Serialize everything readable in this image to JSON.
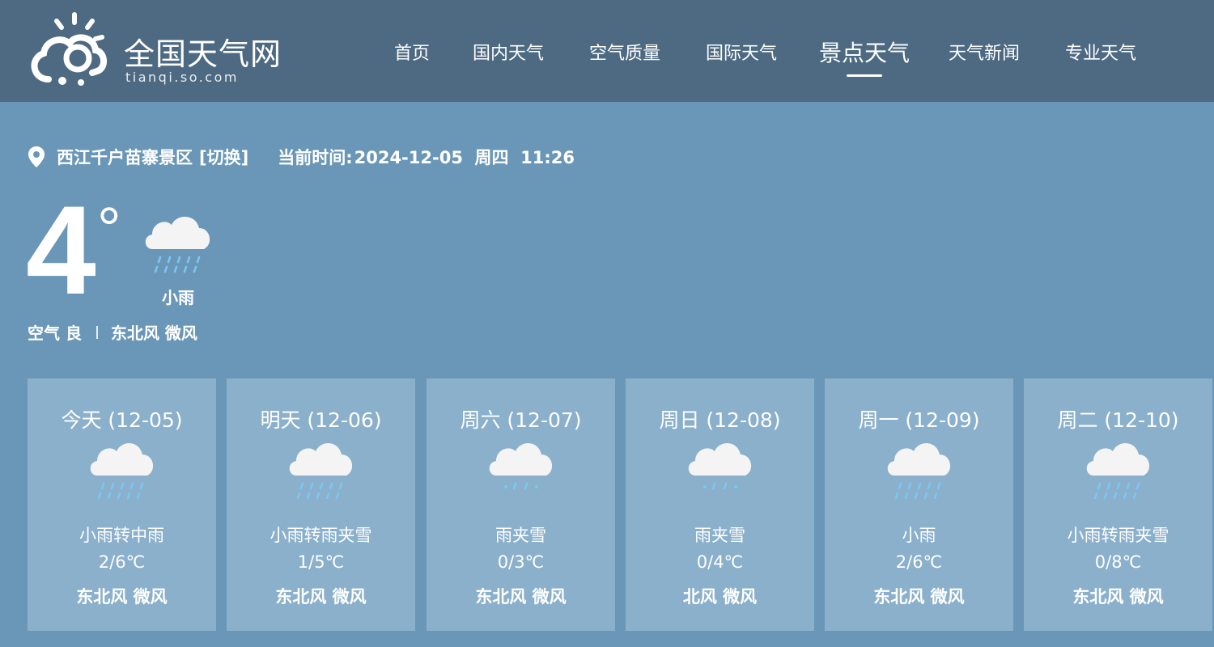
{
  "header": {
    "logo_name": "全国天气网",
    "logo_domain": "tianqi.so.com",
    "nav": [
      "首页",
      "国内天气",
      "空气质量",
      "国际天气",
      "景点天气",
      "天气新闻",
      "专业天气"
    ],
    "active_nav": "景点天气"
  },
  "location": {
    "name": "西江千户苗寨景区",
    "switch_label": "[切换]",
    "time_label": "当前时间:",
    "time_value": "2024-12-05  周四  11:26"
  },
  "current": {
    "temperature": "4",
    "degree_symbol": "°",
    "condition": "小雨",
    "condition_icon": "light-rain-icon",
    "air_quality": "空气 良",
    "wind": "东北风 微风"
  },
  "forecast": [
    {
      "day": "今天 (12-05)",
      "condition": "小雨转中雨",
      "temp": "2/6℃",
      "wind": "东北风 微风",
      "icon": "rain-icon"
    },
    {
      "day": "明天 (12-06)",
      "condition": "小雨转雨夹雪",
      "temp": "1/5℃",
      "wind": "东北风 微风",
      "icon": "rain-icon"
    },
    {
      "day": "周六 (12-07)",
      "condition": "雨夹雪",
      "temp": "0/3℃",
      "wind": "东北风 微风",
      "icon": "sleet-icon"
    },
    {
      "day": "周日 (12-08)",
      "condition": "雨夹雪",
      "temp": "0/4℃",
      "wind": "北风 微风",
      "icon": "sleet-icon"
    },
    {
      "day": "周一 (12-09)",
      "condition": "小雨",
      "temp": "2/6℃",
      "wind": "东北风 微风",
      "icon": "rain-icon"
    },
    {
      "day": "周二 (12-10)",
      "condition": "小雨转雨夹雪",
      "temp": "0/8℃",
      "wind": "东北风 微风",
      "icon": "rain-icon"
    }
  ],
  "colors": {
    "header_bg": "#4d6a82",
    "page_bg": "#6a97b8",
    "card_bg": "#8bb0cb",
    "cloud": "#f4f4f4",
    "rain": "#7ac7f2"
  }
}
